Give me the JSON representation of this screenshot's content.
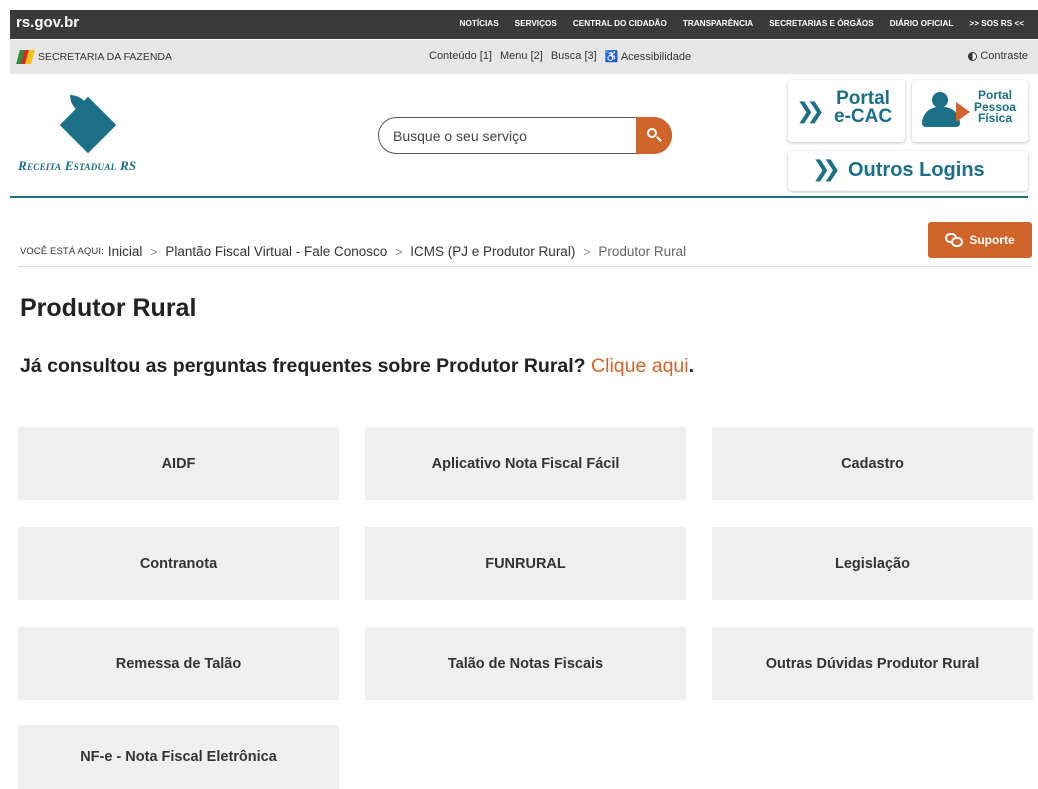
{
  "topbar": {
    "brand": "rs.gov.br",
    "nav": [
      "NOTÍCIAS",
      "SERVIÇOS",
      "CENTRAL DO CIDADÃO",
      "TRANSPARÊNCIA",
      "SECRETARIAS E ÓRGÃOS",
      "DIÁRIO OFICIAL",
      ">> SOS RS <<"
    ]
  },
  "secbar": {
    "secretaria": "SECRETARIA DA FAZENDA",
    "shortcuts": [
      "Conteúdo [1]",
      "Menu [2]",
      "Busca [3]",
      "♿ Acessibilidade"
    ],
    "contrast": "Contraste"
  },
  "header": {
    "logo_text": "Receita Estadual RS",
    "search_placeholder": "Busque o seu serviço",
    "portal_ecac_line1": "Portal",
    "portal_ecac_line2": "e-CAC",
    "portal_pf_line1": "Portal",
    "portal_pf_line2": "Pessoa",
    "portal_pf_line3": "Física",
    "outros_logins": "Outros Logins"
  },
  "breadcrumb": {
    "you_are_here": "VOCÊ ESTÁ AQUI:",
    "items": [
      "Inicial",
      "Plantão Fiscal Virtual - Fale Conosco",
      "ICMS (PJ e Produtor Rural)"
    ],
    "current": "Produtor Rural",
    "separator": ">"
  },
  "suporte": "Suporte",
  "page": {
    "title": "Produtor Rural",
    "faq_text": "Já consultou as perguntas frequentes sobre Produtor Rural?",
    "faq_link": "Clique aqui",
    "faq_end": "."
  },
  "tiles": [
    "AIDF",
    "Aplicativo Nota Fiscal Fácil",
    "Cadastro",
    "Contranota",
    "FUNRURAL",
    "Legislação",
    "Remessa de Talão",
    "Talão de Notas Fiscais",
    "Outras Dúvidas Produtor Rural",
    "NF-e - Nota Fiscal Eletrônica"
  ],
  "colors": {
    "accent": "#d0642a",
    "brand": "#1b6f86",
    "topbar": "#3a3a3a"
  }
}
